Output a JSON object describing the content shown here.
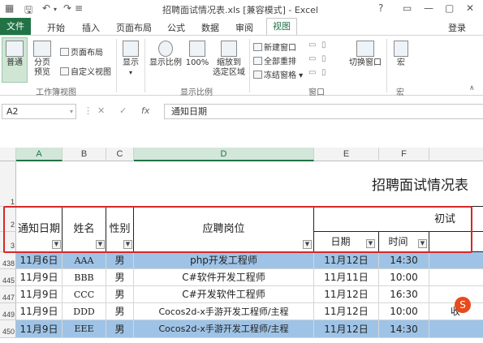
{
  "window": {
    "title": "招聘面试情况表.xls  [兼容模式] - Excel",
    "controls": [
      "?",
      "▭",
      "—",
      "▢",
      "✕"
    ]
  },
  "ribbon_tabs": [
    "文件",
    "开始",
    "插入",
    "页面布局",
    "公式",
    "数据",
    "审阅",
    "视图"
  ],
  "active_tab": "视图",
  "login": "登录",
  "ribbon": {
    "workbook_views": {
      "normal": "普通",
      "page_break": [
        "分页",
        "预览"
      ],
      "page_layout": "页面布局",
      "custom_view": "自定义视图",
      "group_label": "工作簿视图"
    },
    "show": {
      "label": "显示",
      "arrow": "▾"
    },
    "zoom": {
      "zoom": "显示比例",
      "zoom100": "100%",
      "zoom_selection": [
        "缩放到",
        "选定区域"
      ],
      "group_label": "显示比例"
    },
    "window": {
      "new_window": "新建窗口",
      "arrange_all": "全部重排",
      "freeze_panes": "冻结窗格 ▾",
      "switch_windows": "切换窗口",
      "group_label": "窗口"
    },
    "macros": {
      "label": "宏",
      "group_label": "宏"
    }
  },
  "formula_bar": {
    "name_box": "A2",
    "cancel": "✕",
    "enter": "✓",
    "fx": "fx",
    "content": "通知日期"
  },
  "columns": [
    "A",
    "B",
    "C",
    "D",
    "E",
    "F"
  ],
  "selected_columns": [
    "A",
    "D"
  ],
  "sheet": {
    "title": "招聘面试情况表",
    "header_row2": {
      "notice_date": "通知日期",
      "name": "姓名",
      "gender": "性别",
      "position": "应聘岗位",
      "first_interview": "初试"
    },
    "header_row3": {
      "date": "日期",
      "time": "时间"
    },
    "row_numbers": [
      "1",
      "2",
      "3",
      "438",
      "445",
      "447",
      "449",
      "450"
    ],
    "rows": [
      {
        "notice": "11月6日",
        "name": "AAA",
        "gender": "男",
        "position": "php开发工程师",
        "date": "11月12日",
        "time": "14:30",
        "extra": "",
        "highlight": true
      },
      {
        "notice": "11月9日",
        "name": "BBB",
        "gender": "男",
        "position": "C#软件开发工程师",
        "date": "11月11日",
        "time": "10:00",
        "extra": "",
        "highlight": false
      },
      {
        "notice": "11月9日",
        "name": "CCC",
        "gender": "男",
        "position": "C#开发软件工程师",
        "date": "11月12日",
        "time": "16:30",
        "extra": "",
        "highlight": false
      },
      {
        "notice": "11月9日",
        "name": "DDD",
        "gender": "男",
        "position": "Cocos2d-x手游开发工程师/主程",
        "date": "11月12日",
        "time": "10:00",
        "extra": "收",
        "highlight": false
      },
      {
        "notice": "11月9日",
        "name": "EEE",
        "gender": "男",
        "position": "Cocos2d-x手游开发工程师/主程",
        "date": "11月12日",
        "time": "14:30",
        "extra": "",
        "highlight": true
      }
    ]
  },
  "colors": {
    "excel_green": "#217346",
    "row_highlight": "#9ec3e6",
    "annotation_red": "#d62828"
  }
}
